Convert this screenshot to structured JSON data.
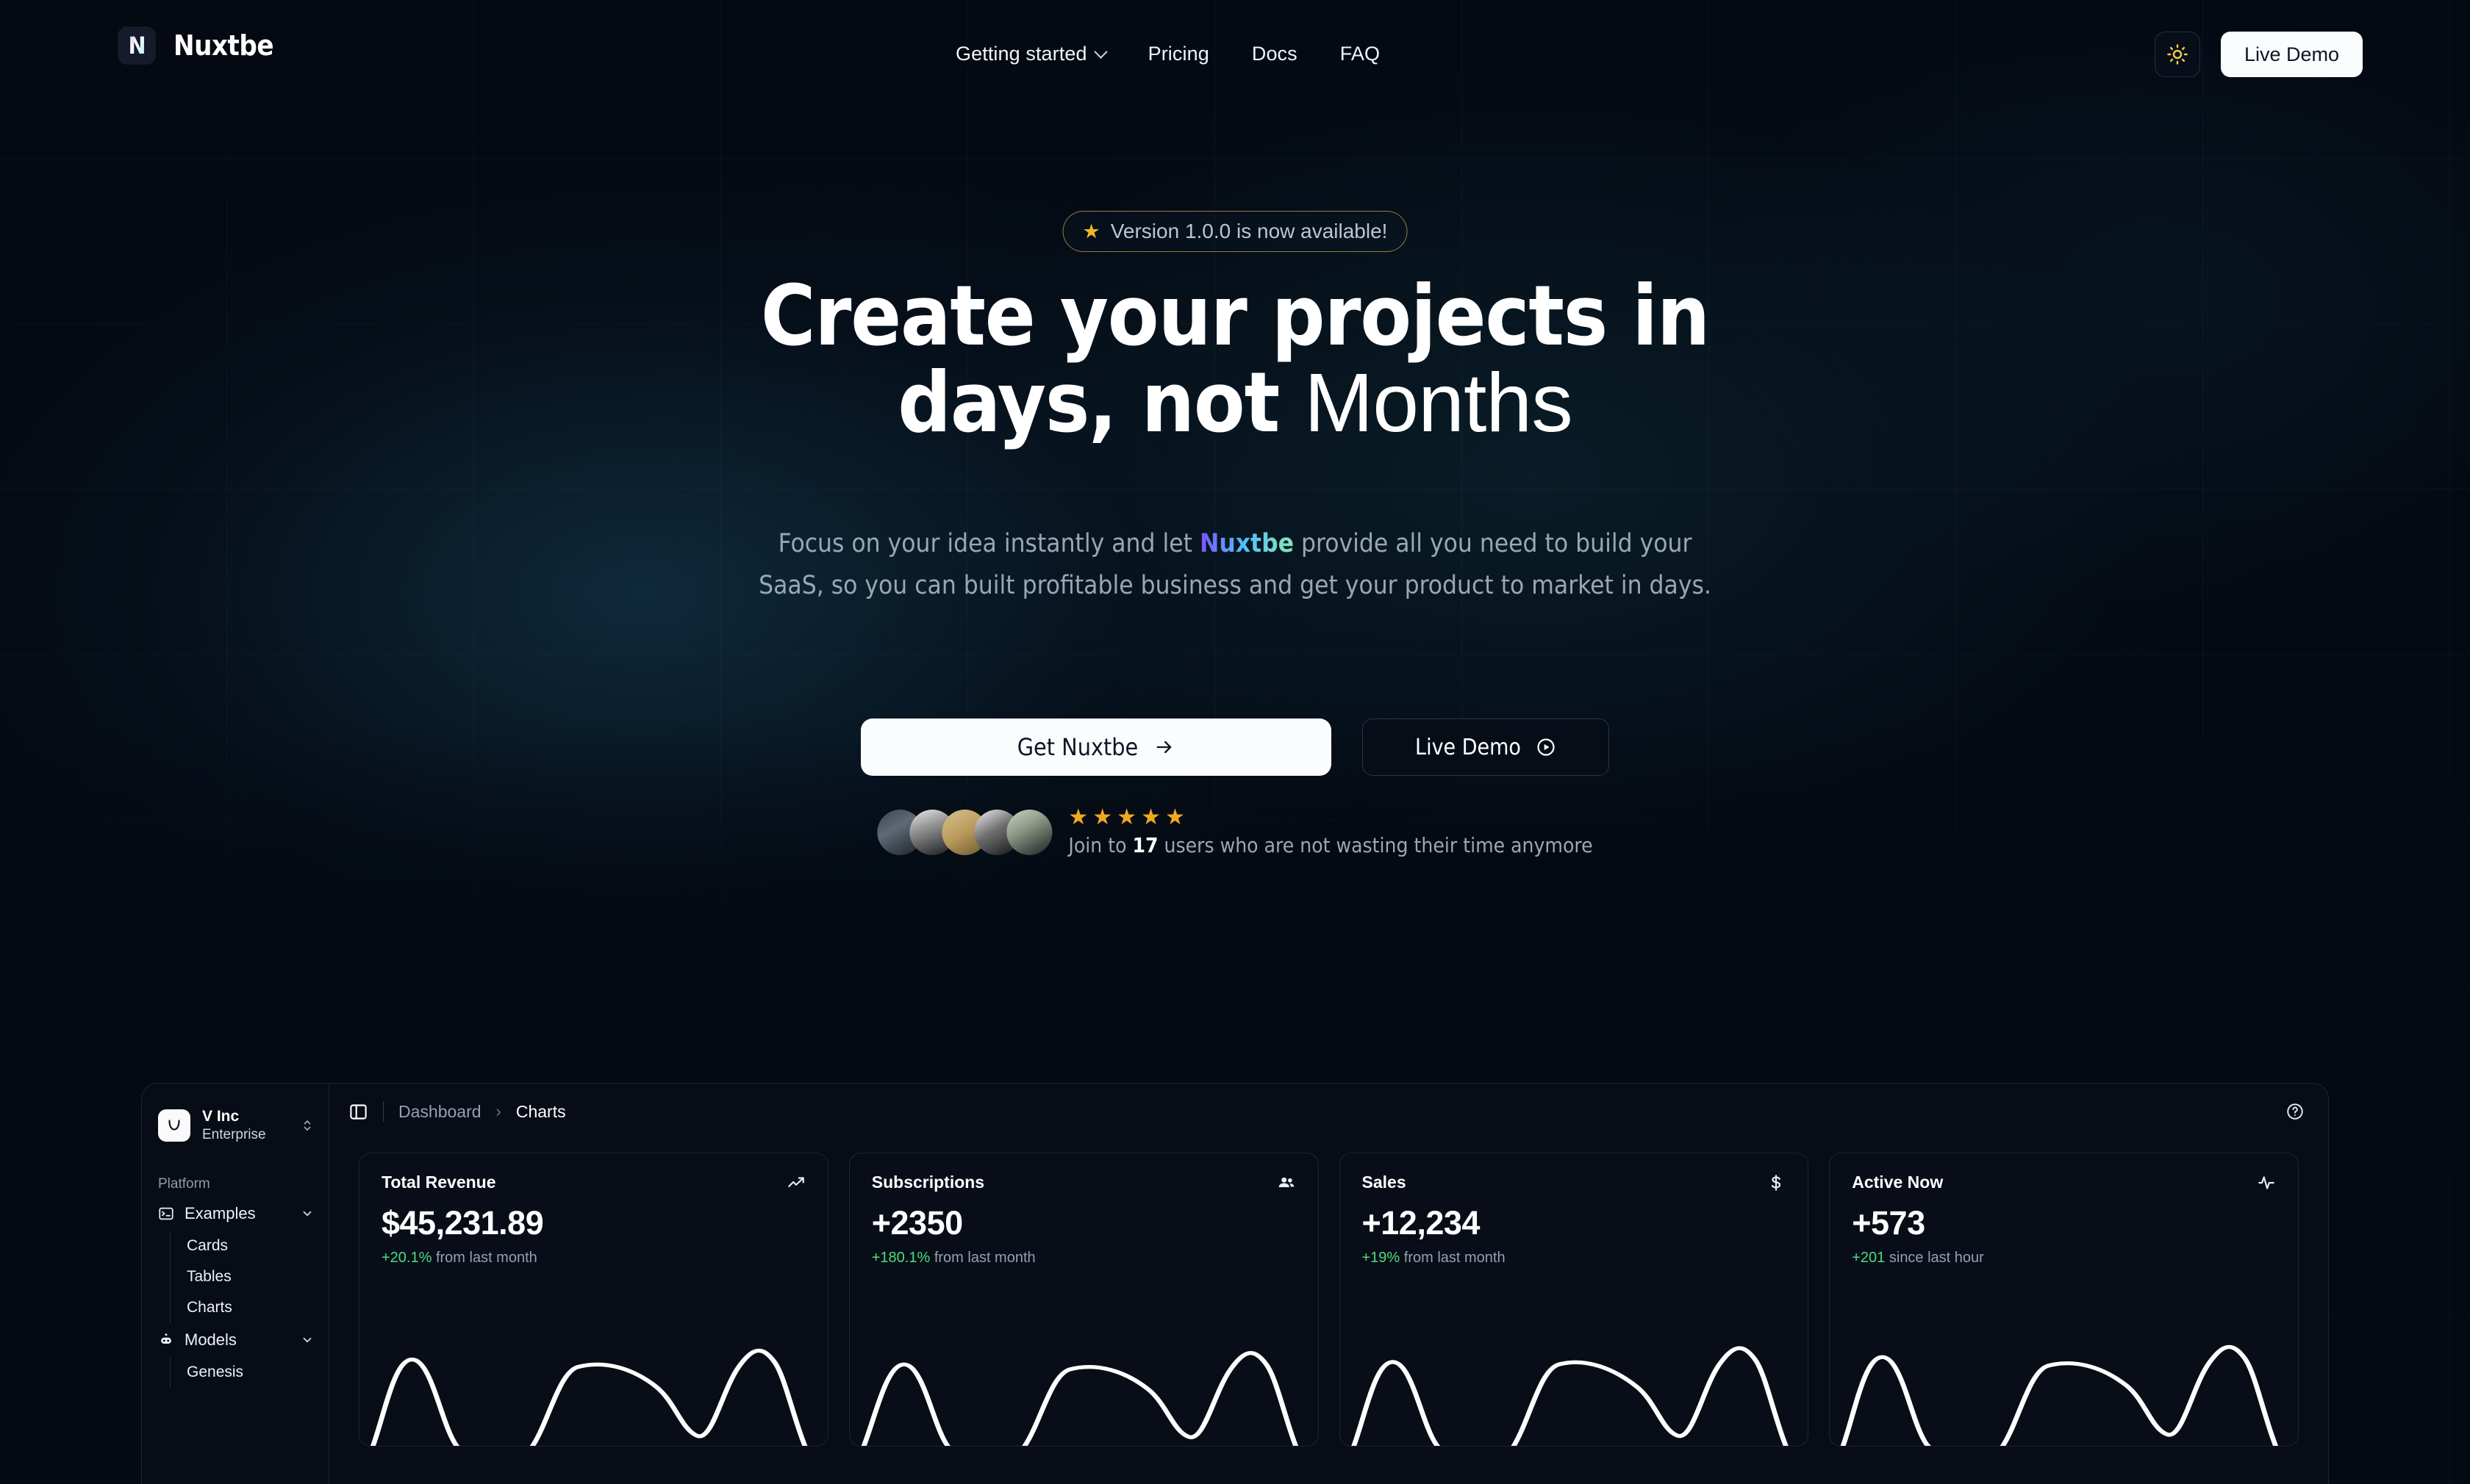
{
  "brand": {
    "mark": "N",
    "name": "Nuxtbe"
  },
  "nav": {
    "items": [
      {
        "label": "Getting started",
        "has_chevron": true
      },
      {
        "label": "Pricing",
        "has_chevron": false
      },
      {
        "label": "Docs",
        "has_chevron": false
      },
      {
        "label": "FAQ",
        "has_chevron": false
      }
    ],
    "theme_toggle_icon": "sun-icon",
    "live_demo_label": "Live Demo"
  },
  "hero": {
    "badge_star": "★",
    "badge_text": "Version 1.0.0 is now available!",
    "headline_line1": "Create your projects in",
    "headline_line2_plain": "days, not ",
    "headline_line2_alt": "Months",
    "subtitle_part1": "Focus on your idea instantly and let ",
    "subtitle_brand": "Nuxtbe",
    "subtitle_part2": " provide all you need to build your SaaS, so you can built profitable business and get your product to market in days.",
    "cta_primary": "Get Nuxtbe",
    "cta_primary_icon": "arrow-right-icon",
    "cta_secondary": "Live Demo",
    "cta_secondary_icon": "play-circle-icon",
    "stars": [
      "★",
      "★",
      "★",
      "★",
      "★"
    ],
    "social_prefix": "Join to ",
    "social_count": "17",
    "social_suffix": " users who are not wasting their time anymore"
  },
  "dashboard": {
    "org": {
      "logo_letter": "V",
      "name": "V Inc",
      "plan": "Enterprise",
      "caret_icon": "chevron-up-down-icon"
    },
    "sidebar": {
      "group_label": "Platform",
      "groups": [
        {
          "label": "Examples",
          "icon": "terminal-icon",
          "caret": "chevron-down-icon",
          "children": [
            "Cards",
            "Tables",
            "Charts"
          ]
        },
        {
          "label": "Models",
          "icon": "bot-icon",
          "caret": "chevron-down-icon",
          "children": [
            "Genesis"
          ]
        }
      ]
    },
    "topbar": {
      "toggle_icon": "sidebar-toggle-icon",
      "breadcrumb_root": "Dashboard",
      "breadcrumb_sep": "›",
      "breadcrumb_current": "Charts",
      "help_icon": "help-circle-icon"
    },
    "cards": [
      {
        "title": "Total Revenue",
        "icon": "trending-up-icon",
        "value": "$45,231.89",
        "delta": "+20.1%",
        "delta_suffix": " from last month"
      },
      {
        "title": "Subscriptions",
        "icon": "users-icon",
        "value": "+2350",
        "delta": "+180.1%",
        "delta_suffix": " from last month"
      },
      {
        "title": "Sales",
        "icon": "dollar-sign-icon",
        "value": "+12,234",
        "delta": "+19%",
        "delta_suffix": " from last month"
      },
      {
        "title": "Active Now",
        "icon": "activity-icon",
        "value": "+573",
        "delta": "+201",
        "delta_suffix": " since last hour"
      }
    ]
  },
  "colors": {
    "page_bg": "#040912",
    "accent_white": "#fbfcfd",
    "badge_border": "#c4a046",
    "star_gold": "#f0a91f",
    "delta_green": "#4ade80",
    "muted_text": "#99a7b4"
  },
  "chart_data": {
    "type": "line",
    "title": "Card sparklines",
    "xlabel": "",
    "ylabel": "",
    "grid": false,
    "legend": "none",
    "series": [
      {
        "name": "Total Revenue",
        "values": [
          0,
          62,
          16,
          2,
          84,
          90,
          70,
          18,
          96,
          4
        ]
      },
      {
        "name": "Subscriptions",
        "values": [
          0,
          58,
          18,
          4,
          86,
          88,
          66,
          20,
          94,
          6
        ]
      },
      {
        "name": "Sales",
        "values": [
          0,
          60,
          14,
          3,
          88,
          86,
          64,
          22,
          95,
          5
        ]
      },
      {
        "name": "Active Now",
        "values": [
          0,
          64,
          17,
          3,
          82,
          92,
          68,
          19,
          97,
          4
        ]
      }
    ]
  }
}
